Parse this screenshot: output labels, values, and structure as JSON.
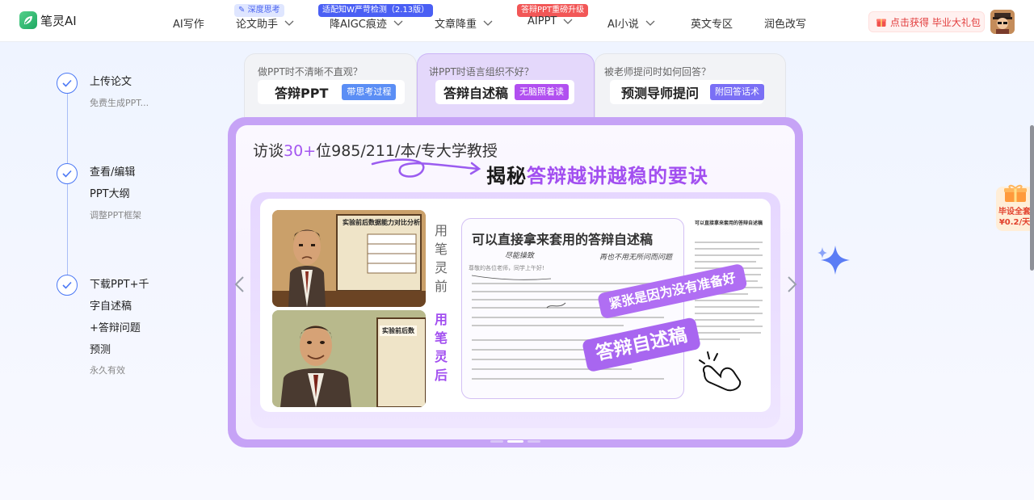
{
  "header": {
    "logo_text": "笔灵AI",
    "nav": [
      {
        "label": "AI写作",
        "has_chevron": false
      },
      {
        "label": "论文助手",
        "has_chevron": true,
        "badge": "深度思考"
      },
      {
        "label": "降AIGC痕迹",
        "has_chevron": true,
        "badge": "适配知W严苛检测（2.13版）"
      },
      {
        "label": "文章降重",
        "has_chevron": true
      },
      {
        "label": "AIPPT",
        "has_chevron": true,
        "badge": "答辩PPT重磅升级"
      },
      {
        "label": "AI小说",
        "has_chevron": true
      },
      {
        "label": "英文专区",
        "has_chevron": false
      },
      {
        "label": "润色改写",
        "has_chevron": false
      }
    ],
    "promo_label": "点击获得 毕业大礼包"
  },
  "steps": [
    {
      "title_lines": [
        "上传论文"
      ],
      "sub": "免费生成PPT..."
    },
    {
      "title_lines": [
        "查看/编辑",
        "PPT大纲"
      ],
      "sub": "调整PPT框架"
    },
    {
      "title_lines": [
        "下载PPT+千",
        "字自述稿",
        "+答辩问题",
        "预测"
      ],
      "sub": "永久有效"
    }
  ],
  "tabs": [
    {
      "question": "做PPT时不清晰不直观？",
      "title": "答辩PPT",
      "tag": "带思考过程",
      "active": false
    },
    {
      "question": "讲PPT时语言组织不好？",
      "title": "答辩自述稿",
      "tag": "无脑照着读",
      "active": true
    },
    {
      "question": "被老师提问时如何回答？",
      "title": "预测导师提问",
      "tag": "附回答话术",
      "active": false
    }
  ],
  "banner": {
    "top_prefix": "访谈",
    "top_highlight": "30+",
    "top_suffix": "位985/211/本/专大学教授",
    "headline_dark": "揭秘",
    "headline_purple": "答辩越讲越稳的要诀",
    "before_label": "用笔灵前",
    "after_label": "用笔灵后",
    "illus_top_board": "实验前后数据能力对比分析",
    "illus_bottom_board": "实验前后数",
    "doc_title": "可以直接拿来套用的答辩自述稿",
    "doc_greeting": "尊敬的各位老师，同学上午好!",
    "doc_handwrite_1": "尽能操致",
    "doc_handwrite_2": "再也不用无所问而问题",
    "doc_small_title": "可以直接拿来套用的答辩自述稿",
    "sticker_1": "紧张是因为没有准备好",
    "sticker_2": "答辩自述稿"
  },
  "side_gift": {
    "line1": "毕设全套",
    "line2": "¥0.2/天"
  },
  "colors": {
    "accent_purple": "#a24ff0",
    "accent_blue": "#4b78f5",
    "badge_red": "#f25757"
  }
}
